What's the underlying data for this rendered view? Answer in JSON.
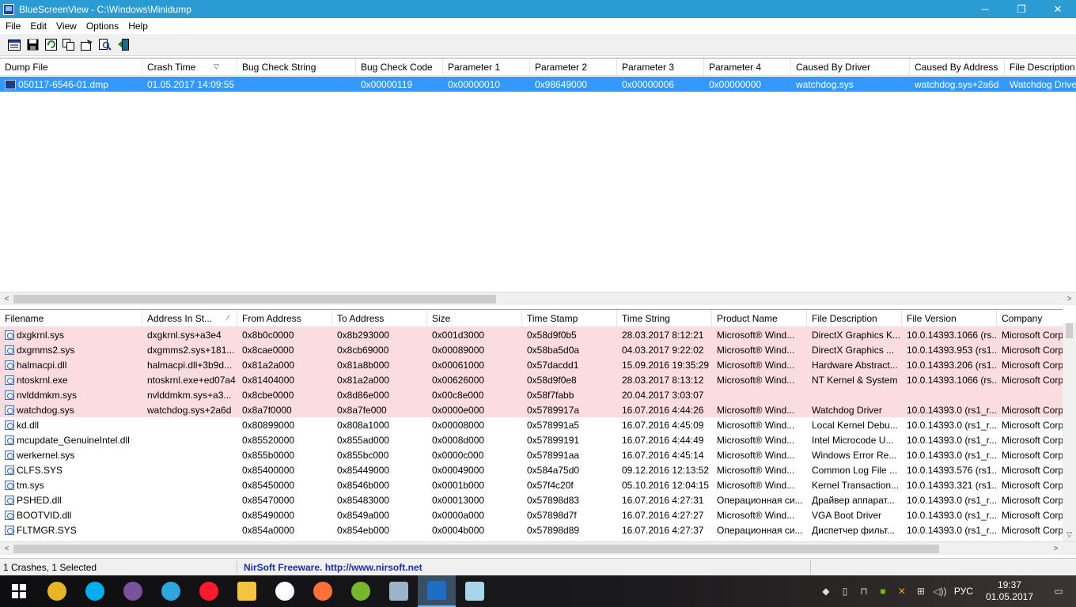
{
  "window": {
    "title": "BlueScreenView  -  C:\\Windows\\Minidump",
    "minimize": "─",
    "maximize": "❐",
    "close": "✕"
  },
  "menu": [
    "File",
    "Edit",
    "View",
    "Options",
    "Help"
  ],
  "toolbar_icons": [
    "properties-icon",
    "save-icon",
    "refresh-icon",
    "copy-icon",
    "options-icon",
    "find-icon",
    "exit-icon"
  ],
  "crash_list": {
    "columns": [
      "Dump File",
      "Crash Time",
      "Bug Check String",
      "Bug Check Code",
      "Parameter 1",
      "Parameter 2",
      "Parameter 3",
      "Parameter 4",
      "Caused By Driver",
      "Caused By Address",
      "File Description"
    ],
    "rows": [
      [
        "050117-6546-01.dmp",
        "01.05.2017 14:09:55",
        "",
        "0x00000119",
        "0x00000010",
        "0x98649000",
        "0x00000006",
        "0x00000000",
        "watchdog.sys",
        "watchdog.sys+2a6d",
        "Watchdog Driver"
      ]
    ]
  },
  "driver_list": {
    "columns": [
      "Filename",
      "Address In St...",
      "From Address",
      "To Address",
      "Size",
      "Time Stamp",
      "Time String",
      "Product Name",
      "File Description",
      "File Version",
      "Company"
    ],
    "rows": [
      {
        "highlight": true,
        "cells": [
          "dxgkrnl.sys",
          "dxgkrnl.sys+a3e4",
          "0x8b0c0000",
          "0x8b293000",
          "0x001d3000",
          "0x58d9f0b5",
          "28.03.2017 8:12:21",
          "Microsoft® Wind...",
          "DirectX Graphics K...",
          "10.0.14393.1066 (rs...",
          "Microsoft Corp"
        ]
      },
      {
        "highlight": true,
        "cells": [
          "dxgmms2.sys",
          "dxgmms2.sys+181...",
          "0x8cae0000",
          "0x8cb69000",
          "0x00089000",
          "0x58ba5d0a",
          "04.03.2017 9:22:02",
          "Microsoft® Wind...",
          "DirectX Graphics ...",
          "10.0.14393.953 (rs1...",
          "Microsoft Corp"
        ]
      },
      {
        "highlight": true,
        "cells": [
          "halmacpi.dll",
          "halmacpi.dll+3b9d...",
          "0x81a2a000",
          "0x81a8b000",
          "0x00061000",
          "0x57dacdd1",
          "15.09.2016 19:35:29",
          "Microsoft® Wind...",
          "Hardware Abstract...",
          "10.0.14393.206 (rs1...",
          "Microsoft Corp"
        ]
      },
      {
        "highlight": true,
        "cells": [
          "ntoskrnl.exe",
          "ntoskrnl.exe+ed07a4",
          "0x81404000",
          "0x81a2a000",
          "0x00626000",
          "0x58d9f0e8",
          "28.03.2017 8:13:12",
          "Microsoft® Wind...",
          "NT Kernel & System",
          "10.0.14393.1066 (rs...",
          "Microsoft Corp"
        ]
      },
      {
        "highlight": true,
        "cells": [
          "nvlddmkm.sys",
          "nvlddmkm.sys+a3...",
          "0x8cbe0000",
          "0x8d86e000",
          "0x00c8e000",
          "0x58f7fabb",
          "20.04.2017 3:03:07",
          "",
          "",
          "",
          ""
        ]
      },
      {
        "highlight": true,
        "cells": [
          "watchdog.sys",
          "watchdog.sys+2a6d",
          "0x8a7f0000",
          "0x8a7fe000",
          "0x0000e000",
          "0x5789917a",
          "16.07.2016 4:44:26",
          "Microsoft® Wind...",
          "Watchdog Driver",
          "10.0.14393.0 (rs1_r...",
          "Microsoft Corp"
        ]
      },
      {
        "highlight": false,
        "cells": [
          "kd.dll",
          "",
          "0x80899000",
          "0x808a1000",
          "0x00008000",
          "0x578991a5",
          "16.07.2016 4:45:09",
          "Microsoft® Wind...",
          "Local Kernel Debu...",
          "10.0.14393.0 (rs1_r...",
          "Microsoft Corp"
        ]
      },
      {
        "highlight": false,
        "cells": [
          "mcupdate_GenuineIntel.dll",
          "",
          "0x85520000",
          "0x855ad000",
          "0x0008d000",
          "0x57899191",
          "16.07.2016 4:44:49",
          "Microsoft® Wind...",
          "Intel Microcode U...",
          "10.0.14393.0 (rs1_r...",
          "Microsoft Corp"
        ]
      },
      {
        "highlight": false,
        "cells": [
          "werkernel.sys",
          "",
          "0x855b0000",
          "0x855bc000",
          "0x0000c000",
          "0x578991aa",
          "16.07.2016 4:45:14",
          "Microsoft® Wind...",
          "Windows Error Re...",
          "10.0.14393.0 (rs1_r...",
          "Microsoft Corp"
        ]
      },
      {
        "highlight": false,
        "cells": [
          "CLFS.SYS",
          "",
          "0x85400000",
          "0x85449000",
          "0x00049000",
          "0x584a75d0",
          "09.12.2016 12:13:52",
          "Microsoft® Wind...",
          "Common Log File ...",
          "10.0.14393.576 (rs1...",
          "Microsoft Corp"
        ]
      },
      {
        "highlight": false,
        "cells": [
          "tm.sys",
          "",
          "0x85450000",
          "0x8546b000",
          "0x0001b000",
          "0x57f4c20f",
          "05.10.2016 12:04:15",
          "Microsoft® Wind...",
          "Kernel Transaction...",
          "10.0.14393.321 (rs1...",
          "Microsoft Corp"
        ]
      },
      {
        "highlight": false,
        "cells": [
          "PSHED.dll",
          "",
          "0x85470000",
          "0x85483000",
          "0x00013000",
          "0x57898d83",
          "16.07.2016 4:27:31",
          "Операционная си...",
          "Драйвер аппарат...",
          "10.0.14393.0 (rs1_r...",
          "Microsoft Corp"
        ]
      },
      {
        "highlight": false,
        "cells": [
          "BOOTVID.dll",
          "",
          "0x85490000",
          "0x8549a000",
          "0x0000a000",
          "0x57898d7f",
          "16.07.2016 4:27:27",
          "Microsoft® Wind...",
          "VGA Boot Driver",
          "10.0.14393.0 (rs1_r...",
          "Microsoft Corp"
        ]
      },
      {
        "highlight": false,
        "cells": [
          "FLTMGR.SYS",
          "",
          "0x854a0000",
          "0x854eb000",
          "0x0004b000",
          "0x57898d89",
          "16.07.2016 4:27:37",
          "Операционная си...",
          "Диспетчер фильт...",
          "10.0.14393.0 (rs1_r...",
          "Microsoft Corp"
        ]
      }
    ]
  },
  "status": {
    "selection": "1 Crashes, 1 Selected",
    "link": "NirSoft Freeware.  http://www.nirsoft.net"
  },
  "taskbar": {
    "apps": [
      {
        "name": "chrome-icon",
        "color": "#e8b622"
      },
      {
        "name": "skype-icon",
        "color": "#00aff0"
      },
      {
        "name": "viber-icon",
        "color": "#7b519d"
      },
      {
        "name": "telegram-icon",
        "color": "#2ca5e0"
      },
      {
        "name": "opera-icon",
        "color": "#ff1b2d"
      },
      {
        "name": "file-explorer-icon",
        "color": "#f5c342"
      },
      {
        "name": "yandex-browser-icon",
        "color": "#ffffff"
      },
      {
        "name": "firefox-icon",
        "color": "#ff7139"
      },
      {
        "name": "utorrent-icon",
        "color": "#77b82a"
      },
      {
        "name": "control-panel-icon",
        "color": "#9ab4cc"
      },
      {
        "name": "bluescreenview-icon",
        "color": "#1d6dc4"
      },
      {
        "name": "notepad-icon",
        "color": "#a7d5ea"
      }
    ],
    "language": "РУС",
    "time": "19:37",
    "date": "01.05.2017"
  }
}
